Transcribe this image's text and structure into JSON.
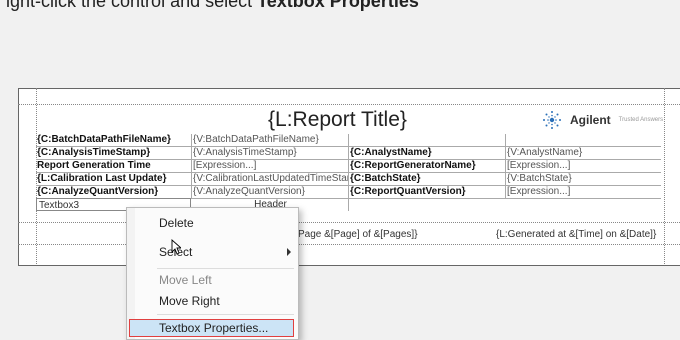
{
  "top_caption": {
    "prefix": "ight-click the control and select ",
    "bold": "Textbox Properties"
  },
  "report": {
    "title": "{L:Report Title}",
    "logo": {
      "brand": "Agilent",
      "tagline": "Trusted Answers"
    },
    "rows": [
      [
        "{C:BatchDataPathFileName}",
        "{V:BatchDataPathFileName}",
        "",
        ""
      ],
      [
        "{C:AnalysisTimeStamp}",
        "{V:AnalysisTimeStamp}",
        "{C:AnalystName}",
        "{V:AnalystName}"
      ],
      [
        "Report Generation Time",
        "[Expression...]",
        "{C:ReportGeneratorName}",
        "[Expression...]"
      ],
      [
        "{L:Calibration Last Update}",
        "{V:CalibrationLastUpdatedTimeStam",
        "{C:BatchState}",
        "{V:BatchState}"
      ],
      [
        "{C:AnalyzeQuantVersion}",
        "{V:AnalyzeQuantVersion}",
        "{C:ReportQuantVersion}",
        "[Expression...]"
      ]
    ],
    "textbox3": "Textbox3",
    "header_cell": "Header",
    "footer_page": "Page &[Page] of &[Pages]}",
    "footer_generated": "{L:Generated at &[Time] on &[Date]}"
  },
  "context_menu": {
    "items": [
      {
        "label": "Delete",
        "enabled": true
      },
      {
        "label": "Select",
        "enabled": true,
        "submenu": true
      },
      {
        "label": "Move Left",
        "enabled": false
      },
      {
        "label": "Move Right",
        "enabled": true
      },
      {
        "label": "Textbox Properties...",
        "enabled": true,
        "highlighted": true
      }
    ]
  },
  "colors": {
    "highlight": "#cce4f6",
    "highlight_border": "#e04040",
    "logo_blue": "#2a6fb8"
  }
}
